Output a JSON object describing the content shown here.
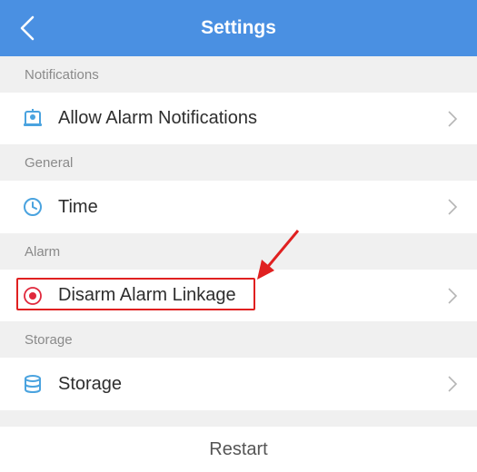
{
  "header": {
    "title": "Settings",
    "back_icon": "chevron-left-icon"
  },
  "sections": {
    "notifications": {
      "title": "Notifications",
      "item": {
        "label": "Allow Alarm Notifications",
        "icon": "notification-bell-icon"
      }
    },
    "general": {
      "title": "General",
      "item": {
        "label": "Time",
        "icon": "clock-icon"
      }
    },
    "alarm": {
      "title": "Alarm",
      "item": {
        "label": "Disarm Alarm Linkage",
        "icon": "alarm-dot-icon"
      }
    },
    "storage": {
      "title": "Storage",
      "item": {
        "label": "Storage",
        "icon": "database-icon"
      }
    }
  },
  "footer": {
    "restart_label": "Restart"
  },
  "colors": {
    "header_bg": "#4a90e2",
    "icon_blue": "#4aa3df",
    "icon_red": "#e0283c",
    "highlight_red": "#e02020",
    "section_bg": "#f0f0f0"
  }
}
